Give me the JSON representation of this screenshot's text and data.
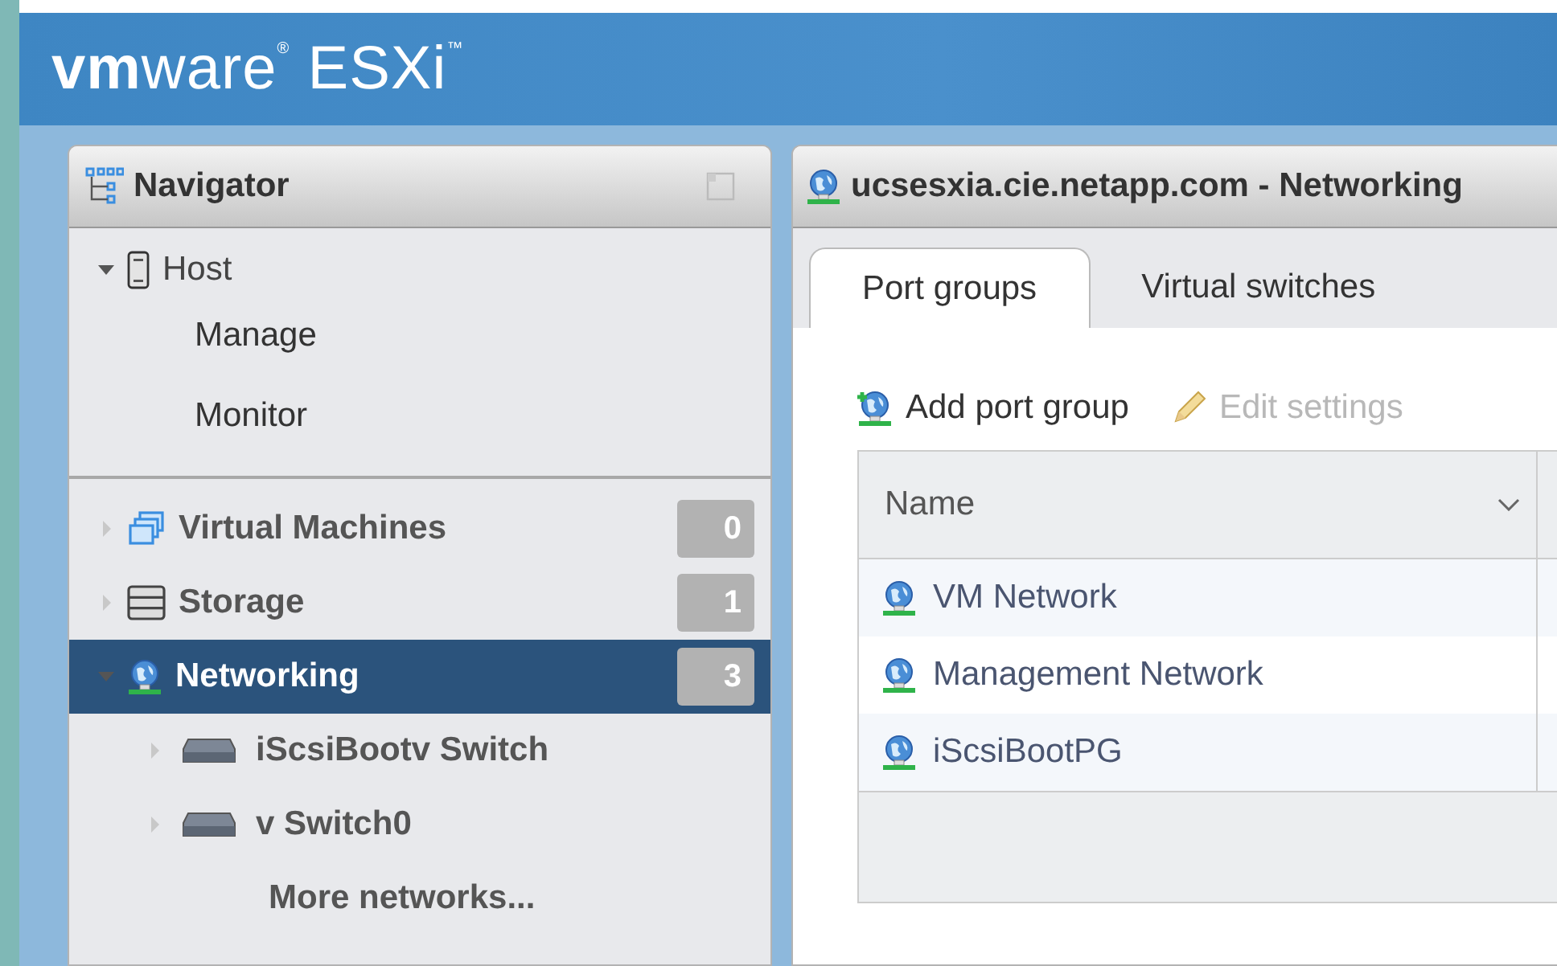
{
  "header": {
    "logo": "**vm**ware$^{®}$ ESXi$^{™}$"
  },
  "navigator": {
    "title": "Navigator",
    "items": [
      {
        "kind": "host",
        "label": "Host",
        "expanded": true,
        "children": [
          {
            "kind": "page",
            "label": "Manage"
          },
          {
            "kind": "page",
            "label": "Monitor"
          }
        ]
      },
      {
        "kind": "vms",
        "label": "Virtual Machines",
        "count": "0",
        "expanded": false,
        "selected": false
      },
      {
        "kind": "storage",
        "label": "Storage",
        "count": "1",
        "expanded": false,
        "selected": false
      },
      {
        "kind": "network",
        "label": "Networking",
        "count": "3",
        "expanded": true,
        "selected": true,
        "children": [
          {
            "kind": "switch",
            "label": "iScsiBootv Switch",
            "expanded": false
          },
          {
            "kind": "switch",
            "label": "v Switch0",
            "expanded": false
          },
          {
            "kind": "more",
            "label": "More networks..."
          }
        ]
      }
    ]
  },
  "main": {
    "title": "ucsesxia.cie.netapp.com - Networking",
    "tabs": [
      {
        "label": "Port groups",
        "selected": true
      },
      {
        "label": "Virtual switches",
        "selected": false
      }
    ],
    "toolbar": [
      {
        "kind": "add",
        "label": "Add port group",
        "disabled": false
      },
      {
        "kind": "edit",
        "label": "Edit settings",
        "disabled": true
      }
    ],
    "table": {
      "columns": [
        "Name"
      ],
      "rows": [
        {
          "name": "VM Network"
        },
        {
          "name": "Management Network"
        },
        {
          "name": "iScsiBootPG"
        }
      ]
    }
  }
}
